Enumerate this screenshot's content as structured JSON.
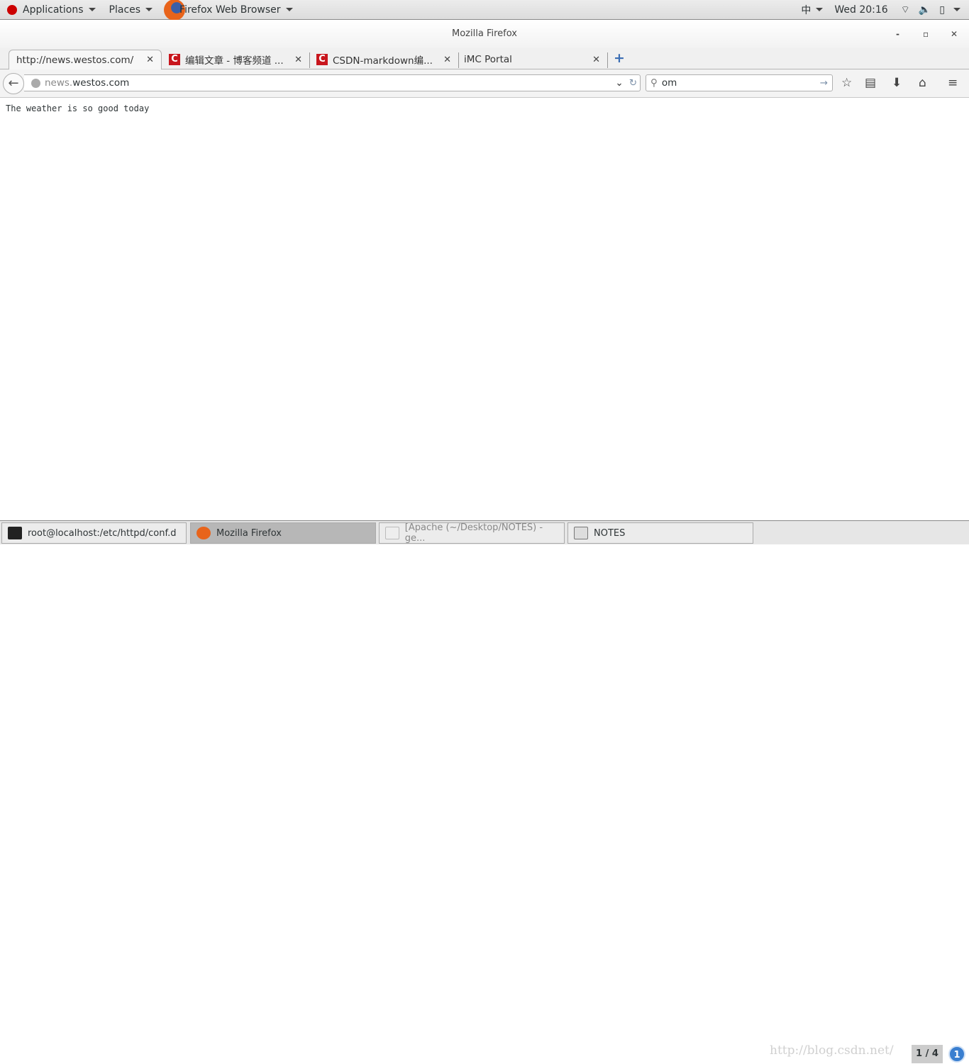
{
  "topbar": {
    "applications": "Applications",
    "places": "Places",
    "app_name": "Firefox Web Browser",
    "input_method": "中",
    "clock": "Wed 20:16"
  },
  "window": {
    "title": "Mozilla Firefox"
  },
  "tabs": [
    {
      "label": "http://news.westos.com/"
    },
    {
      "label": "编辑文章 - 博客频道 ..."
    },
    {
      "label": "CSDN-markdown编..."
    },
    {
      "label": "iMC Portal"
    }
  ],
  "navbar": {
    "url_prefix": "news.",
    "url_domain": "westos.com",
    "search_value": "om"
  },
  "page": {
    "text": "The weather is so good today"
  },
  "taskbar": {
    "items": [
      {
        "label": "root@localhost:/etc/httpd/conf.d"
      },
      {
        "label": "Mozilla Firefox"
      },
      {
        "label": "[Apache (~/Desktop/NOTES) - ge..."
      },
      {
        "label": "NOTES"
      }
    ],
    "workspace": "1 / 4",
    "notifications": "1",
    "watermark": "http://blog.csdn.net/"
  },
  "colors": {
    "csdn": "#c8161d",
    "accent": "#3a7fd0"
  }
}
